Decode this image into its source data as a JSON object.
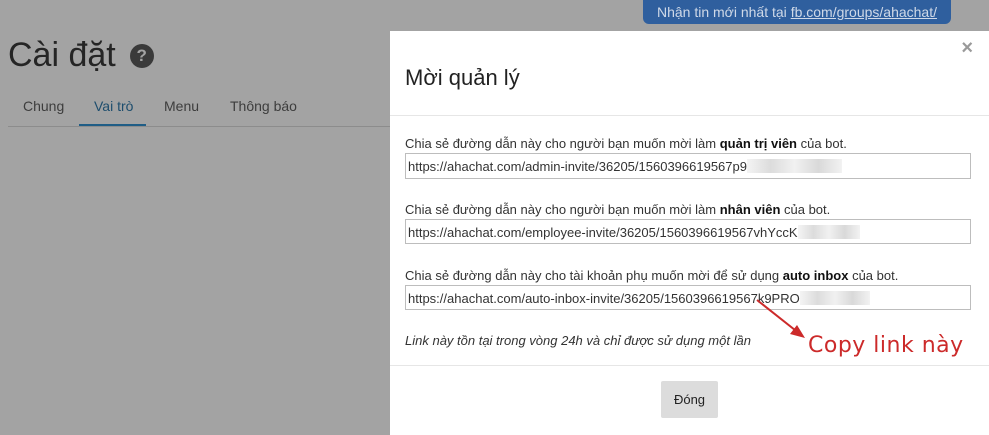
{
  "announcement": {
    "text": "Nhận tin mới nhất tại ",
    "link": "fb.com/groups/ahachat/"
  },
  "page": {
    "title": "Cài đặt",
    "help_glyph": "?",
    "tabs": [
      "Chung",
      "Vai trò",
      "Menu",
      "Thông báo"
    ],
    "active_tab": "Vai trò"
  },
  "modal": {
    "close_glyph": "×",
    "title": "Mời quản lý",
    "fields": [
      {
        "label_prefix": "Chia sẻ đường dẫn này cho người bạn muốn mời làm ",
        "label_bold": "quản trị viên",
        "label_suffix": " của bot.",
        "value": "https://ahachat.com/admin-invite/36205/1560396619567p9"
      },
      {
        "label_prefix": "Chia sẻ đường dẫn này cho người bạn muốn mời làm ",
        "label_bold": "nhân viên",
        "label_suffix": " của bot.",
        "value": "https://ahachat.com/employee-invite/36205/1560396619567vhYccK"
      },
      {
        "label_prefix": "Chia sẻ đường dẫn này cho tài khoản phụ muốn mời để sử dụng ",
        "label_bold": "auto inbox",
        "label_suffix": " của bot.",
        "value": "https://ahachat.com/auto-inbox-invite/36205/1560396619567k9PRO"
      }
    ],
    "note": "Link này tồn tại trong vòng 24h và chỉ được sử dụng một lần",
    "close_button": "Đóng"
  },
  "annotation": {
    "text": "Copy link này",
    "color": "#cc2a2a"
  },
  "colors": {
    "overlay": "#a3a3a3",
    "announcement_bg": "#2f5f9e",
    "active_tab": "#1f5d86"
  }
}
